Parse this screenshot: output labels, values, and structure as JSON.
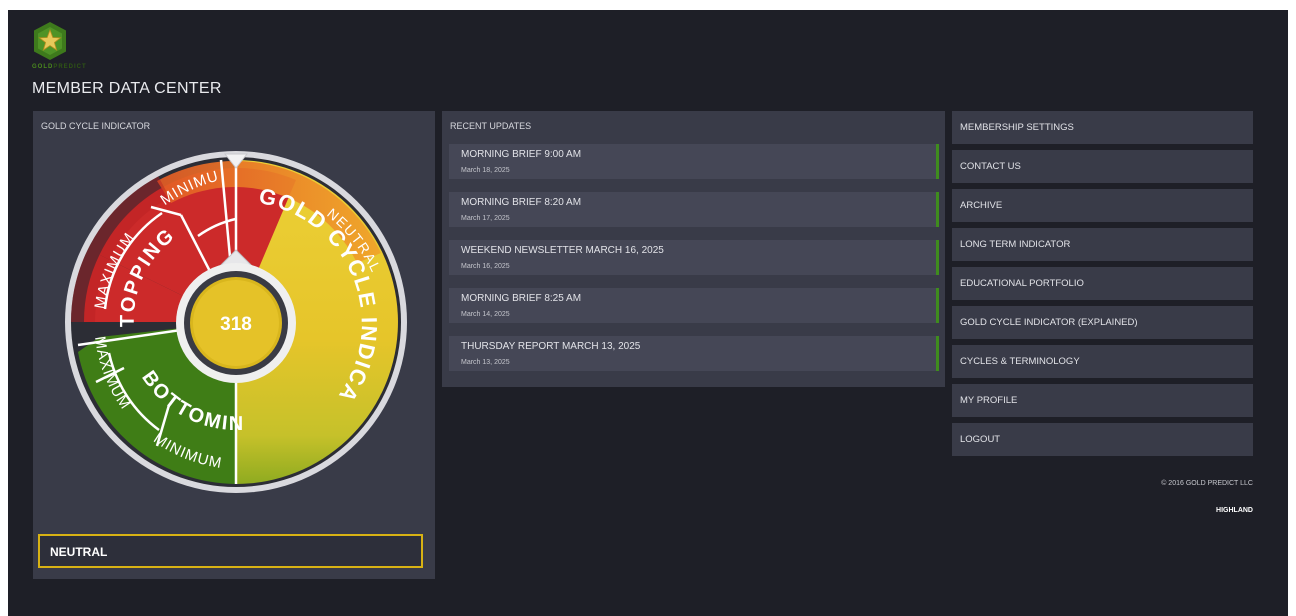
{
  "brand": {
    "name_part1": "GOLD",
    "name_part2": "PREDICT"
  },
  "page_title": "MEMBER DATA CENTER",
  "indicator": {
    "panel_title": "GOLD CYCLE INDICATOR",
    "value": "318",
    "status": "NEUTRAL",
    "wheel_labels": {
      "ring_minimum_top": "MINIMUM",
      "ring_maximum_top": "MAXIMUM",
      "topping": "TOPPING",
      "bottoming": "BOTTOMING",
      "ring_maximum_bottom": "MAXIMUM",
      "ring_minimum_bottom": "MINIMUM",
      "title": "GOLD CYCLE INDICATOR",
      "neutral": "NEUTRAL"
    },
    "colors": {
      "topping": "#cc2a2a",
      "bottoming": "#3f7d16",
      "neutral": "#e8c32a",
      "accent": "#e57a1e"
    }
  },
  "updates": {
    "panel_title": "RECENT UPDATES",
    "items": [
      {
        "title": "MORNING BRIEF 9:00 AM",
        "date": "March 18, 2025"
      },
      {
        "title": "MORNING BRIEF 8:20 AM",
        "date": "March 17, 2025"
      },
      {
        "title": "WEEKEND NEWSLETTER MARCH 16, 2025",
        "date": "March 16, 2025"
      },
      {
        "title": "MORNING BRIEF 8:25 AM",
        "date": "March 14, 2025"
      },
      {
        "title": "THURSDAY REPORT MARCH 13, 2025",
        "date": "March 13, 2025"
      }
    ]
  },
  "menu": [
    "MEMBERSHIP SETTINGS",
    "CONTACT US",
    "ARCHIVE",
    "LONG TERM INDICATOR",
    "EDUCATIONAL PORTFOLIO",
    "GOLD CYCLE INDICATOR (EXPLAINED)",
    "CYCLES & TERMINOLOGY",
    "MY PROFILE",
    "LOGOUT"
  ],
  "footer": {
    "copyright": "© 2016 GOLD PREDICT LLC",
    "credit": "HIGHLAND"
  }
}
